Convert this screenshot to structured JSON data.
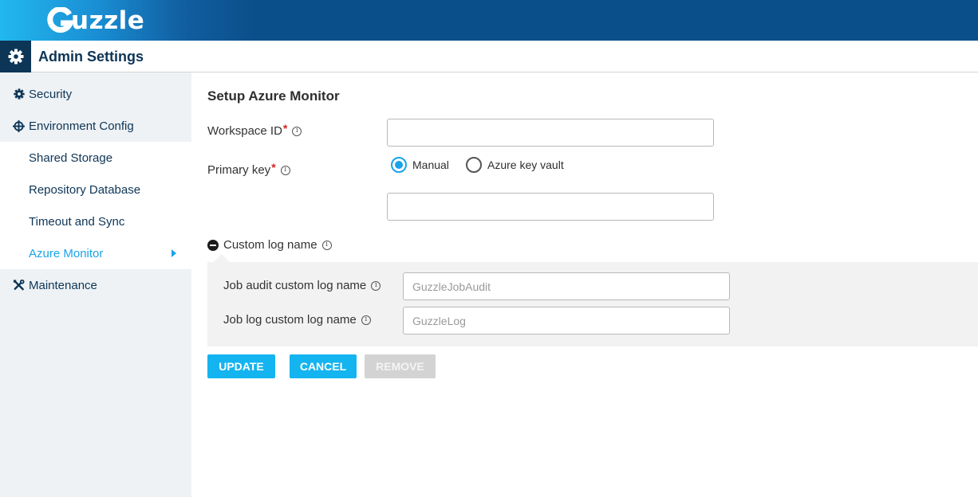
{
  "brand": {
    "logo_text": "uzzle",
    "logo_letter": "G"
  },
  "header": {
    "title": "Admin Settings",
    "icon": "gear-icon"
  },
  "sidebar": {
    "items": [
      {
        "label": "Security",
        "icon": "gear-icon"
      },
      {
        "label": "Environment Config",
        "icon": "crosshair-icon"
      },
      {
        "label": "Shared Storage"
      },
      {
        "label": "Repository Database"
      },
      {
        "label": "Timeout and Sync"
      },
      {
        "label": "Azure Monitor",
        "active": true
      },
      {
        "label": "Maintenance",
        "icon": "tools-icon"
      }
    ]
  },
  "form": {
    "title": "Setup Azure Monitor",
    "workspace_id": {
      "label": "Workspace ID",
      "required_mark": "*",
      "value": ""
    },
    "primary_key": {
      "label": "Primary key",
      "required_mark": "*",
      "options": [
        "Manual",
        "Azure key vault"
      ],
      "selected": "Manual",
      "value": ""
    },
    "custom_log": {
      "label": "Custom log name",
      "expanded": true,
      "job_audit": {
        "label": "Job audit custom log name",
        "placeholder": "GuzzleJobAudit"
      },
      "job_log": {
        "label": "Job log custom log name",
        "placeholder": "GuzzleLog"
      }
    },
    "info_glyph": "i"
  },
  "buttons": {
    "update": "UPDATE",
    "cancel": "CANCEL",
    "remove": "REMOVE"
  },
  "colors": {
    "accent": "#1aa3e8",
    "brand_dark": "#0b4f8a",
    "nav_text": "#0d3556",
    "required": "#d62020"
  }
}
